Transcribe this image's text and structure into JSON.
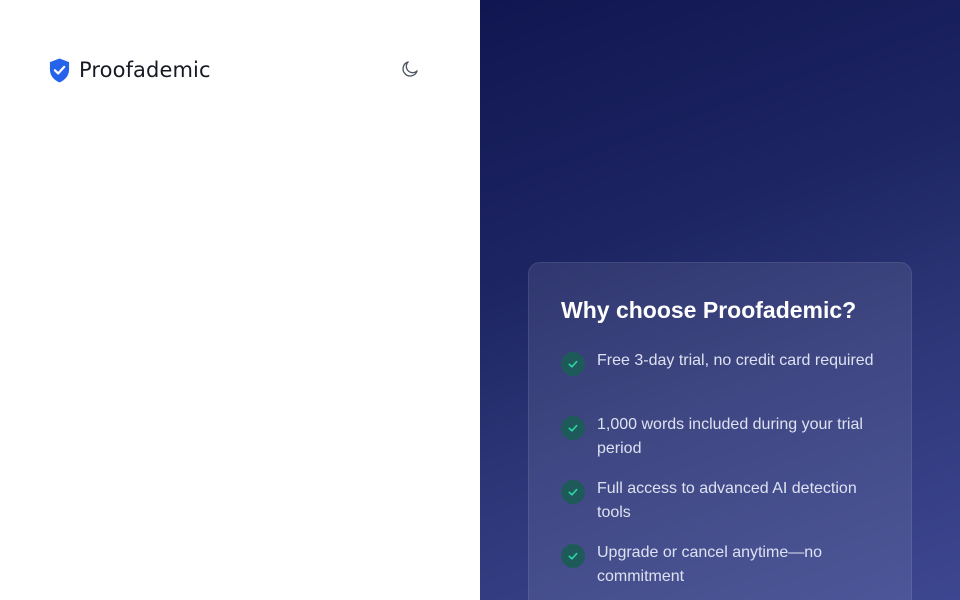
{
  "brand": {
    "name": "Proofademic",
    "logo_icon": "shield-check-icon",
    "logo_color": "#2563eb"
  },
  "header": {
    "theme_toggle_icon": "moon-icon"
  },
  "promo": {
    "title": "Why choose Proofademic?",
    "check_icon": "check-icon",
    "accent_color": "#2dd4a4",
    "features": [
      "Free 3-day trial, no credit card required",
      "1,000 words included during your trial period",
      "Full access to advanced AI detection tools",
      "Upgrade or cancel anytime—no commitment"
    ]
  }
}
